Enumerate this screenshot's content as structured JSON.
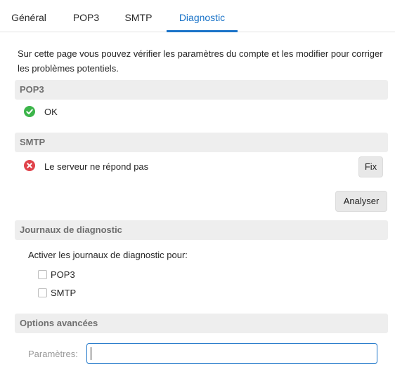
{
  "tabs": [
    {
      "label": "Général",
      "active": false
    },
    {
      "label": "POP3",
      "active": false
    },
    {
      "label": "SMTP",
      "active": false
    },
    {
      "label": "Diagnostic",
      "active": true
    }
  ],
  "intro_text": "Sur cette page vous pouvez vérifier les paramètres du compte et les modifier pour corriger les problèmes potentiels.",
  "pop3_section": {
    "title": "POP3",
    "status_icon": "check-circle-icon",
    "status_color": "#3cb54a",
    "status_text": "OK"
  },
  "smtp_section": {
    "title": "SMTP",
    "status_icon": "error-circle-icon",
    "status_color": "#e0434b",
    "status_text": "Le serveur ne répond pas",
    "fix_label": "Fix"
  },
  "analyze_label": "Analyser",
  "logs_section": {
    "title": "Journaux de diagnostic",
    "prompt": "Activer les journaux de diagnostic pour:",
    "options": [
      {
        "label": "POP3",
        "checked": false
      },
      {
        "label": "SMTP",
        "checked": false
      }
    ]
  },
  "advanced_section": {
    "title": "Options avancées",
    "params_label": "Paramètres:",
    "params_value": ""
  },
  "colors": {
    "accent": "#1a73c8"
  }
}
